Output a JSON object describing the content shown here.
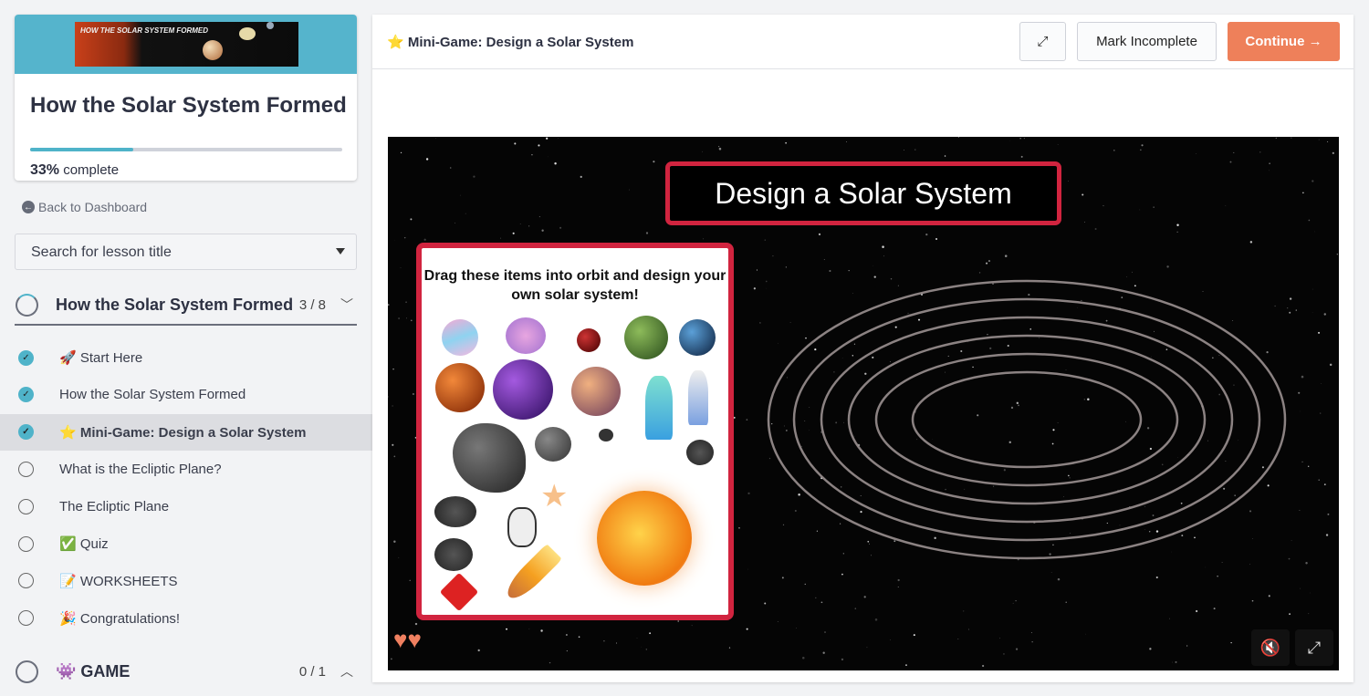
{
  "course": {
    "banner_text": "HOW THE SOLAR SYSTEM FORMED",
    "title": "How the Solar System Formed",
    "progress_percent": 33,
    "progress_value": "33%",
    "progress_suffix": "complete"
  },
  "sidebar": {
    "back_label": "Back to Dashboard",
    "search_placeholder": "Search for lesson title",
    "sections": [
      {
        "label": "How the Solar System Formed",
        "count": "3 / 8",
        "expanded": true
      },
      {
        "label": "👾 GAME",
        "count": "0 / 1",
        "expanded": false
      }
    ],
    "lessons": [
      {
        "label": "🚀 Start Here",
        "done": true
      },
      {
        "label": "How the Solar System Formed",
        "done": true
      },
      {
        "label": "⭐ Mini-Game: Design a Solar System",
        "done": true,
        "active": true
      },
      {
        "label": "What is the Ecliptic Plane?",
        "done": false
      },
      {
        "label": "The Ecliptic Plane",
        "done": false
      },
      {
        "label": "✅ Quiz",
        "done": false
      },
      {
        "label": "📝 WORKSHEETS",
        "done": false
      },
      {
        "label": "🎉 Congratulations!",
        "done": false
      }
    ]
  },
  "header": {
    "title": "⭐ Mini-Game: Design a Solar System",
    "mark_incomplete": "Mark Incomplete",
    "continue": "Continue →",
    "accent": "#ee805a"
  },
  "game": {
    "title": "Design a Solar System",
    "instructions": "Drag these items into orbit and design your own solar system!"
  }
}
